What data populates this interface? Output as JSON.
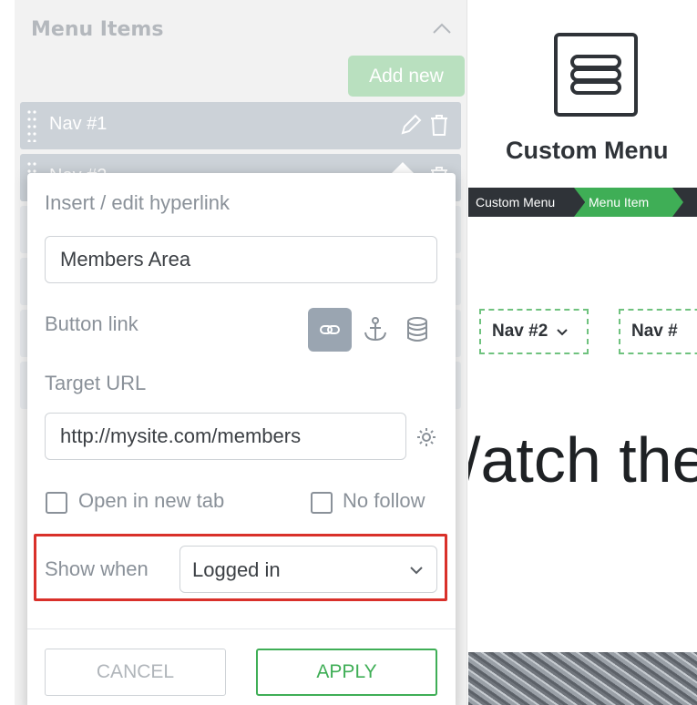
{
  "panel": {
    "title": "Menu Items",
    "add_new": "Add new",
    "nav_items": [
      {
        "label": "Nav #1"
      },
      {
        "label": "Nav #2"
      }
    ]
  },
  "link_dialog": {
    "title": "Insert / edit hyperlink",
    "link_text_value": "Members Area",
    "button_link_label": "Button link",
    "link_types": [
      "link-icon",
      "anchor-icon",
      "database-icon"
    ],
    "target_url_label": "Target URL",
    "target_url_value": "http://mysite.com/members",
    "open_new_tab": {
      "label": "Open in new tab",
      "checked": false
    },
    "no_follow": {
      "label": "No follow",
      "checked": false
    },
    "show_when_label": "Show when",
    "show_when_value": "Logged in",
    "cancel": "CANCEL",
    "apply": "APPLY"
  },
  "preview": {
    "title": "Custom Menu",
    "breadcrumb": [
      "Custom Menu",
      "Menu Item"
    ],
    "nav": [
      {
        "label": "Nav #2"
      },
      {
        "label": "Nav #"
      }
    ],
    "hero_text": "/atch the"
  },
  "colors": {
    "accent_green": "#3fae56",
    "highlight_red": "#d9302a",
    "dark": "#2f3338"
  }
}
